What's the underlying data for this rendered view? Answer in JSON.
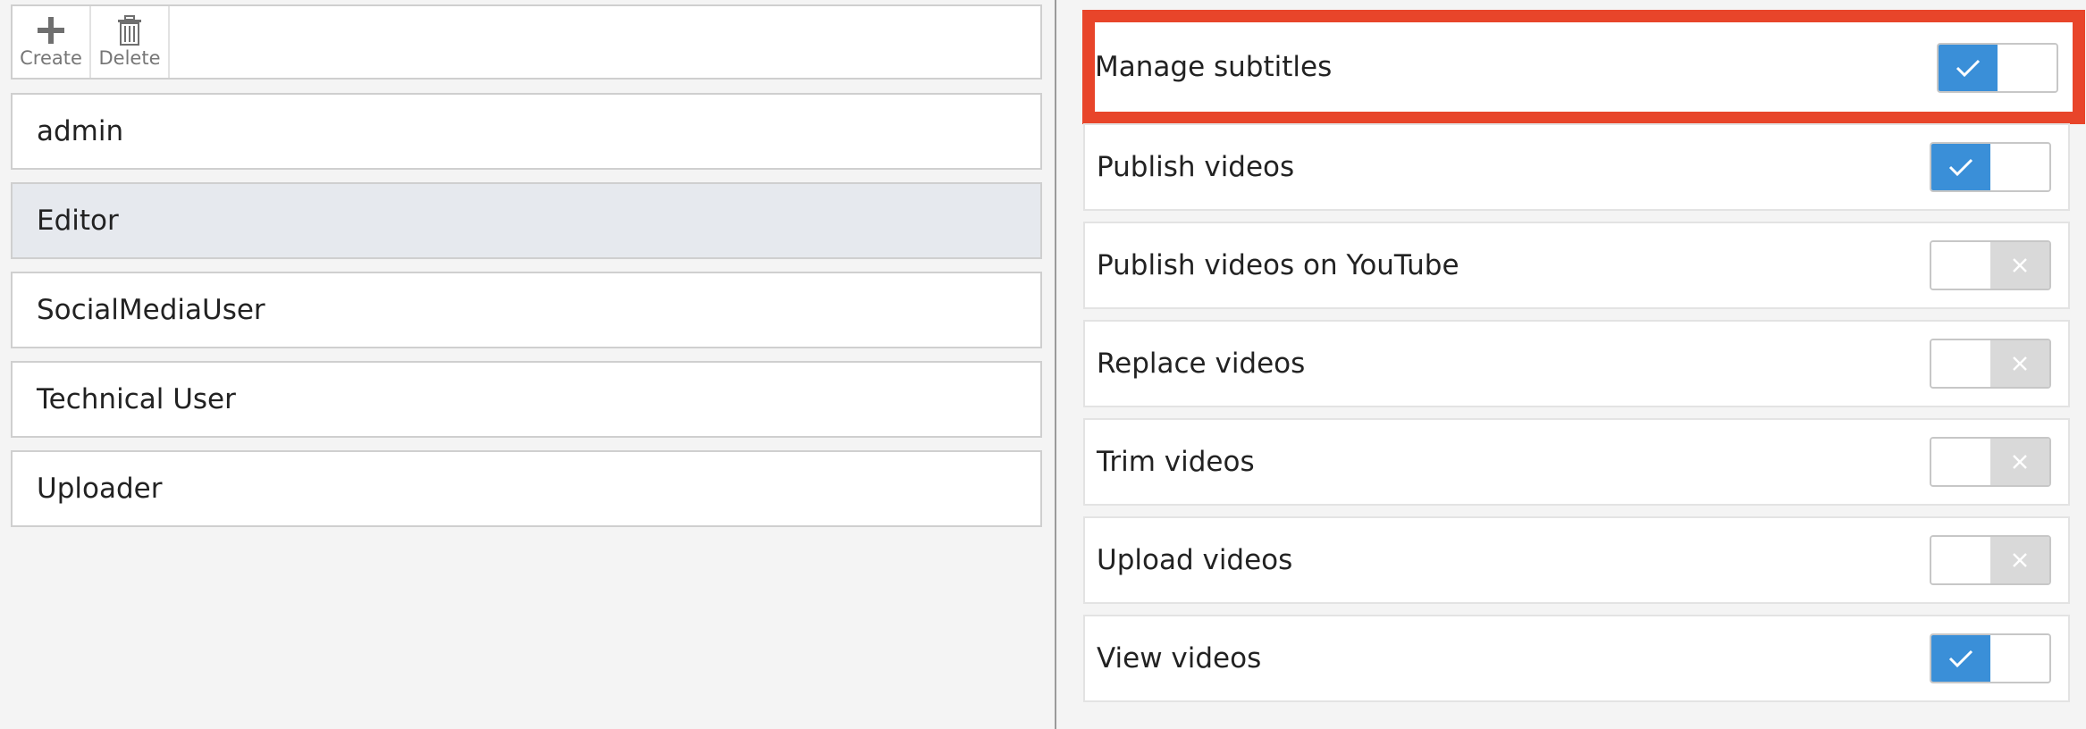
{
  "toolbar": {
    "create_label": "Create",
    "delete_label": "Delete"
  },
  "roles": [
    {
      "name": "admin",
      "selected": false
    },
    {
      "name": "Editor",
      "selected": true
    },
    {
      "name": "SocialMediaUser",
      "selected": false
    },
    {
      "name": "Technical User",
      "selected": false
    },
    {
      "name": "Uploader",
      "selected": false
    }
  ],
  "permissions": [
    {
      "label": "Manage subtitles",
      "enabled": true,
      "highlighted": true
    },
    {
      "label": "Publish videos",
      "enabled": true,
      "highlighted": false
    },
    {
      "label": "Publish videos on YouTube",
      "enabled": false,
      "highlighted": false
    },
    {
      "label": "Replace videos",
      "enabled": false,
      "highlighted": false
    },
    {
      "label": "Trim videos",
      "enabled": false,
      "highlighted": false
    },
    {
      "label": "Upload videos",
      "enabled": false,
      "highlighted": false
    },
    {
      "label": "View videos",
      "enabled": true,
      "highlighted": false
    }
  ],
  "colors": {
    "toggle_on": "#3a8fd8",
    "toggle_off": "#d9d9d9",
    "highlight": "#e8452a",
    "selected_row": "#e6e9ee"
  },
  "icons": {
    "create": "plus-icon",
    "delete": "trash-icon",
    "on": "check-icon",
    "off": "x-icon"
  }
}
